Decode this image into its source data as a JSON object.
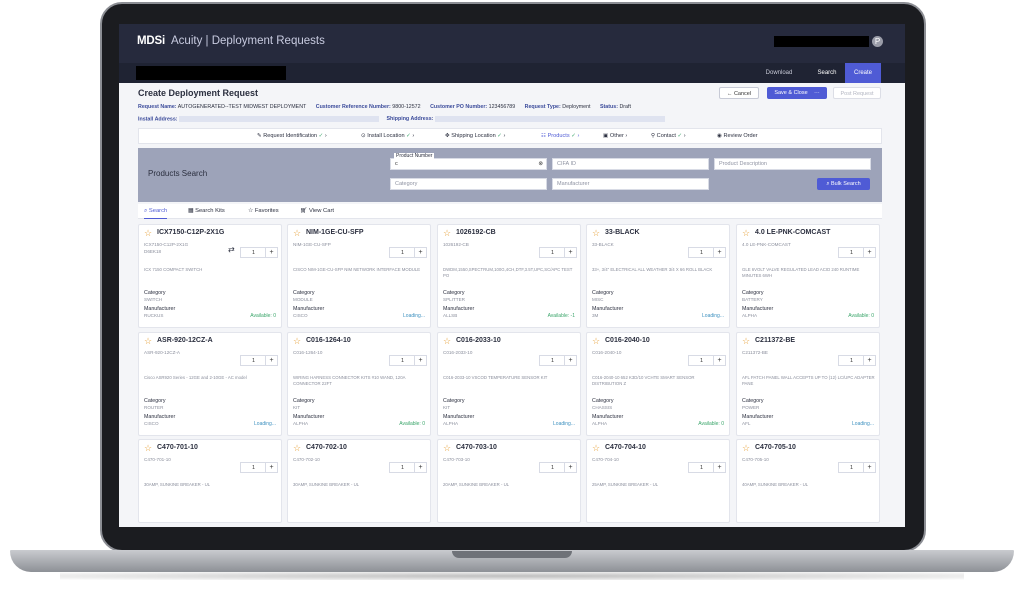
{
  "app": {
    "brand": "MDSi",
    "title": "Acuity | Deployment Requests",
    "avatar_initial": "P"
  },
  "topnav": {
    "download": "Download",
    "search": "Search",
    "create": "Create"
  },
  "page": {
    "title": "Create Deployment Request",
    "meta": {
      "request_name_label": "Request Name:",
      "request_name": "AUTOGENERATED--TEST MIDWEST DEPLOYMENT",
      "customer_ref_label": "Customer Reference Number:",
      "customer_ref": "9800-12572",
      "customer_po_label": "Customer PO Number:",
      "customer_po": "123456789",
      "request_type_label": "Request Type:",
      "request_type": "Deployment",
      "status_label": "Status:",
      "status": "Draft"
    },
    "install_address_label": "Install Address:",
    "shipping_address_label": "Shipping Address:",
    "buttons": {
      "cancel": "← Cancel",
      "save_close": "Save & Close",
      "more": "···",
      "post_request": "Post Request"
    }
  },
  "steps": [
    {
      "label": "Request Identification",
      "check": "✓"
    },
    {
      "label": "Install Location",
      "check": "✓"
    },
    {
      "label": "Shipping Location",
      "check": "✓"
    },
    {
      "label": "Products",
      "check": "✓"
    },
    {
      "label": "Other",
      "check": ""
    },
    {
      "label": "Contact",
      "check": "✓"
    },
    {
      "label": "Review Order",
      "check": ""
    }
  ],
  "search": {
    "title": "Products Search",
    "product_number_label": "Product Number",
    "product_number_value": "c",
    "clfa_placeholder": "CIFA ID",
    "description_placeholder": "Product Description",
    "category_placeholder": "Category",
    "manufacturer_placeholder": "Manufacturer",
    "bulk_search": "Bulk Search"
  },
  "subtabs": {
    "search": "Search",
    "search_kits": "Search Kits",
    "favorites": "Favorites",
    "view_cart": "View Cart"
  },
  "labels": {
    "category": "Category",
    "manufacturer": "Manufacturer"
  },
  "products": [
    {
      "name": "ICX7150-C12P-2X1G",
      "code": "ICX7150-C12P-2X1G",
      "code2": "D6EK18",
      "desc": "ICX 7150 COMPACT SWITCH",
      "qty": "1",
      "category": "SWITCH",
      "manufacturer": "RUCKUS",
      "availability": "Available: 0"
    },
    {
      "name": "NIM-1GE-CU-SFP",
      "code": "NIM-1GE-CU-SFP",
      "code2": "",
      "desc": "CISCO NIM-1GE-CU-SFP NIM NETWORK INTERFACE MODULE",
      "qty": "1",
      "category": "MODULE",
      "manufacturer": "CISCO",
      "availability": "Loading..."
    },
    {
      "name": "1026192-CB",
      "code": "1026192-CB",
      "code2": "",
      "desc": "DWDM,1550,SPECTRUM,100G,4CH,DTF,3.5T,UPC,SC/APC TEST PO",
      "qty": "1",
      "category": "SPLITTER",
      "manufacturer": "ALLSB",
      "availability": "Available: -1"
    },
    {
      "name": "33-BLACK",
      "code": "33-BLACK",
      "code2": "",
      "desc": "33+, 3/4\" ELECTRICAL ALL WEATHER 3/4 X 66 ROLL BLACK",
      "qty": "1",
      "category": "MISC",
      "manufacturer": "3M",
      "availability": "Loading..."
    },
    {
      "name": "4.0 LE-PNK-COMCAST",
      "code": "4.0 LE-PNK-COMCAST",
      "code2": "",
      "desc": "GLE 6VOLT VALVE REGULATED LEAD ACID 240 RUNTIME MINUTES 6WH",
      "qty": "1",
      "category": "BATTERY",
      "manufacturer": "ALPHA",
      "availability": "Available: 0"
    },
    {
      "name": "ASR-920-12CZ-A",
      "code": "ASR-920-12CZ-A",
      "code2": "",
      "desc": "Cisco ASR920 Series - 12GE and 2-10GE - AC model",
      "qty": "1",
      "category": "ROUTER",
      "manufacturer": "CISCO",
      "availability": "Loading..."
    },
    {
      "name": "C016-1264-10",
      "code": "C016-1264-10",
      "code2": "",
      "desc": "WIRING HARNESS CONNECTOR KITS #10 WAND, 120A CONNECTOR 22FT",
      "qty": "1",
      "category": "KIT",
      "manufacturer": "ALPHA",
      "availability": "Available: 0"
    },
    {
      "name": "C016-2033-10",
      "code": "C016-2033-10",
      "code2": "",
      "desc": "C016-2033-10 VSCOD TEMPERATURE SENSOR KIT",
      "qty": "1",
      "category": "KIT",
      "manufacturer": "ALPHA",
      "availability": "Loading..."
    },
    {
      "name": "C016-2040-10",
      "code": "C016-2040-10",
      "code2": "",
      "desc": "C016-2040-10 652 K3D/10 VCHTE SMART SENSOR DISTRIBUTION Z",
      "qty": "1",
      "category": "CHASSIS",
      "manufacturer": "ALPHA",
      "availability": "Available: 0"
    },
    {
      "name": "C211372-BE",
      "code": "C211372-BE",
      "code2": "",
      "desc": "AFL PATCH PANEL WALL ACCEPTS UP TO (12) LC/UPC ADAPTER PANE",
      "qty": "1",
      "category": "POWER",
      "manufacturer": "AFL",
      "availability": "Loading..."
    },
    {
      "name": "C470-701-10",
      "code": "C470-701-10",
      "code2": "",
      "desc": "30AMP, SUNKINE BREAKER - UL",
      "qty": "1",
      "category": "",
      "manufacturer": "",
      "availability": ""
    },
    {
      "name": "C470-702-10",
      "code": "C470-702-10",
      "code2": "",
      "desc": "30AMP, SUNKINE BREAKER - UL",
      "qty": "1",
      "category": "",
      "manufacturer": "",
      "availability": ""
    },
    {
      "name": "C470-703-10",
      "code": "C470-703-10",
      "code2": "",
      "desc": "20AMP, SUNKINE BREAKER - UL",
      "qty": "1",
      "category": "",
      "manufacturer": "",
      "availability": ""
    },
    {
      "name": "C470-704-10",
      "code": "C470-704-10",
      "code2": "",
      "desc": "25AMP, SUNKINE BREAKER - UL",
      "qty": "1",
      "category": "",
      "manufacturer": "",
      "availability": ""
    },
    {
      "name": "C470-705-10",
      "code": "C470-705-10",
      "code2": "",
      "desc": "40AMP, SUNKINE BREAKER - UL",
      "qty": "1",
      "category": "",
      "manufacturer": "",
      "availability": ""
    }
  ],
  "icons": {
    "star": "star-icon",
    "plus": "plus-icon",
    "swap": "swap-icon",
    "search": "search-icon"
  }
}
